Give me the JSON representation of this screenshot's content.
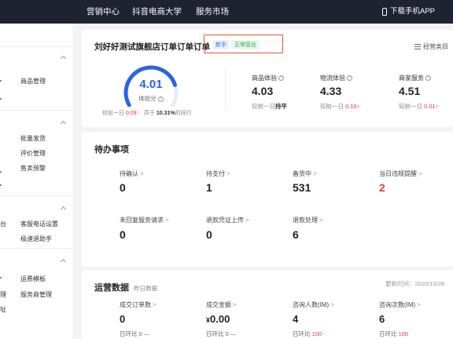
{
  "topbar": {
    "nav": [
      "营销中心",
      "抖音电商大学",
      "服务市场"
    ],
    "app_download": "下载手机APP"
  },
  "sidebar": {
    "items": [
      "商品管理",
      "批量发货",
      "评价管理",
      "售卖预警",
      "客服电话设置",
      "极速退助手",
      "运费模板",
      "服务商管理"
    ],
    "fragments": [
      "台",
      "理",
      "址"
    ]
  },
  "shop": {
    "name": "刘好好测试旗舰店订单订单订单",
    "badge_new": "新手",
    "badge_status": "正常营业",
    "business_category": "经营类目"
  },
  "experience": {
    "score": "4.01",
    "label": "体验分",
    "compare_prefix": "较前一日",
    "compare_change": "0.09",
    "rank_prefix": "高于",
    "rank_value": "10.31%",
    "rank_suffix": "的同行",
    "score_fraction": 0.802
  },
  "metrics": [
    {
      "label": "商品体验",
      "value": "4.03",
      "compare_prefix": "较前一日",
      "compare_value": "持平"
    },
    {
      "label": "物流体验",
      "value": "4.33",
      "compare_prefix": "较前一日",
      "compare_value": "0.16"
    },
    {
      "label": "商家服务",
      "value": "4.51",
      "compare_prefix": "较前一日",
      "compare_value": "0.01"
    }
  ],
  "todo": {
    "title": "待办事项",
    "items": [
      {
        "label": "待确认",
        "value": "0"
      },
      {
        "label": "待支付",
        "value": "1"
      },
      {
        "label": "备货中",
        "value": "531"
      },
      {
        "label": "当日违规提醒",
        "value": "2"
      },
      {
        "label": "未回复服务请求",
        "value": "0"
      },
      {
        "label": "退款凭证上传",
        "value": "0"
      },
      {
        "label": "退款处理",
        "value": "6"
      }
    ]
  },
  "operations": {
    "title": "运营数据",
    "subtitle": "昨日数据",
    "update_time": "更新时间：2020/10/28",
    "items": [
      {
        "label": "成交订单数",
        "value": "0",
        "compare_label": "日环比",
        "compare_value": "0"
      },
      {
        "label": "成交金额",
        "value_prefix": "¥",
        "value": "0.00",
        "compare_label": "日环比",
        "compare_value": "0"
      },
      {
        "label": "咨询人数(IM)",
        "value": "4",
        "compare_label": "日环比",
        "compare_value": "100"
      },
      {
        "label": "咨询次数(IM)",
        "value": "6",
        "compare_label": "日环比",
        "compare_value": "100"
      }
    ]
  },
  "colors": {
    "topbar": "#1f2230",
    "accent": "#2e62e6",
    "alert": "#e43b3b",
    "highlight_box": "#e4572e"
  }
}
